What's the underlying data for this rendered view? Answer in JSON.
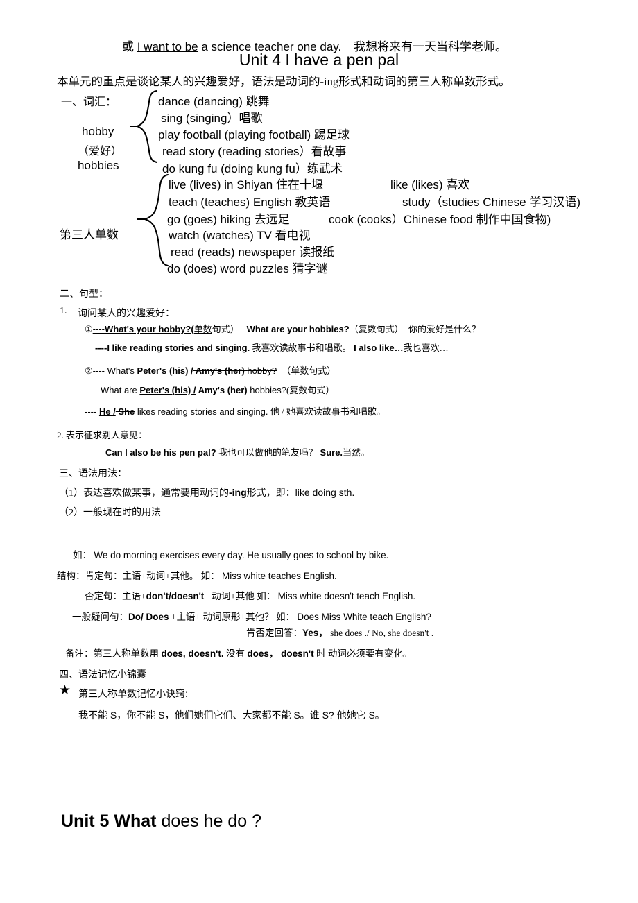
{
  "header": {
    "or_prefix": "或 ",
    "or_underlined": "I want to be",
    "or_rest": " a science teacher one day.",
    "or_translation": "我想将来有一天当科学老师。",
    "unit4_title": "Unit 4  I have a pen pal",
    "intro": "本单元的重点是谈论某人的兴趣爱好，语法是动词的-ing形式和动词的第三人称单数形式。"
  },
  "vocab": {
    "heading": "一、词汇：",
    "group_label_line1": "hobby",
    "group_label_line2": "（爱好）",
    "group_label_line3": "hobbies",
    "items": [
      "dance  (dancing) 跳舞",
      "sing    (singing）唱歌",
      "play football   (playing football) 踢足球",
      "read story   (reading stories）看故事",
      "do kung fu   (doing kung fu）练武术"
    ]
  },
  "third_person": {
    "label": "第三人单数",
    "left_items": [
      "live    (lives)  in Shiyan 住在十堰",
      "teach   (teaches) English 教英语",
      "go   (goes)  hiking  去远足",
      "watch   (watches)   TV  看电视",
      "read   (reads)  newspaper 读报纸",
      "do   (does)  word puzzles  猜字谜"
    ],
    "right_items": [
      "like   (likes)   喜欢",
      "study（studies Chinese 学习汉语)",
      "cook  (cooks）Chinese food 制作中国食物)"
    ]
  },
  "sentences": {
    "heading": "二、句型：",
    "item1_num": "1.",
    "item1_title": "询问某人的兴趣爱好：",
    "line1_circle": "①",
    "line1_dashes": "----",
    "line1_ul": "What's your hobby?(",
    "line1_ul2": "单数",
    "line1_paren": "句式）",
    "line1_strike": "What are  your hobbies?",
    "line1_plural": "（复数句式）",
    "line1_cn": "你的爱好是什么？",
    "line2": "----I like reading stories and singing.",
    "line2_cn": " 我喜欢读故事书和唱歌。",
    "line2_also": " I also like…",
    "line2_also_cn": "我也喜欢…",
    "line3_circle": "②",
    "line3_pre": "---- What's ",
    "line3_ul": "Peter's (his) /",
    "line3_strike": " Amy's (her) ",
    "line3_post": "hobby?",
    "line3_tag": "（单数句式）",
    "line4_pre": "What are ",
    "line4_ul": "Peter's (his) /",
    "line4_strike": " Amy's (her) ",
    "line4_post": " hobbies?",
    "line4_tag": "(复数句式）",
    "line5_pre": "---- ",
    "line5_ul": "He /",
    "line5_strike": " She",
    "line5_post": " likes reading stories and singing.",
    "line5_cn": " 他 / 她喜欢读故事书和唱歌。",
    "item2_title": "2. 表示征求别人意见：",
    "item2_line": "Can I also be his pen pal?",
    "item2_line_cn": " 我也可以做他的笔友吗？",
    "item2_sure": "  Sure.",
    "item2_sure_cn": "当然。"
  },
  "grammar": {
    "heading": "三、语法用法：",
    "point1_pre": "（1）表达喜欢做某事，通常要用动词的",
    "point1_ing": "-ing",
    "point1_post": "形式，即：",
    "point1_en": "like  doing sth.",
    "point2": "（2）一般现在时的用法",
    "example_label": "如：",
    "example_text": "We do morning exercises every day.   He usually goes to school by bike.",
    "struct_label": "结构：肯定句：主语+动词+其他。",
    "struct_ru": " 如：",
    "struct_example": "Miss white teaches English.",
    "neg_label": "否定句：主语+",
    "neg_label_b": "don't/doesn't",
    "neg_label2": " +动词+其他",
    "neg_ru": "  如：",
    "neg_example": "Miss white doesn't  teach English.",
    "ques_label": "一般疑问句：",
    "ques_label_b": "Do/ Does",
    "ques_label2": " +主语+ 动词原形+其他？",
    "ques_ru": " 如：",
    "ques_example": "Does Miss White teach English?",
    "answer_label": "肯否定回答：",
    "answer_yes": "Yes，",
    "answer_rest": "she does ./ No, she doesn't .",
    "note_label": "备注：第三人称单数用 ",
    "note_b1": "does, doesn't.",
    "note_mid": " 没有 ",
    "note_b2": "does， doesn't",
    "note_end": " 时 动词必须要有变化。"
  },
  "memory": {
    "heading": "四、语法记忆小锦囊",
    "star_icon": "★",
    "tip_title": "第三人称单数记忆小诀窍:",
    "tip_body": "我不能 S，你不能 S，他们她们它们、大家都不能 S。谁 S? 他她它 S。"
  },
  "footer": {
    "unit5_pre": "Unit 5 What",
    "unit5_post": " does he do ?"
  }
}
